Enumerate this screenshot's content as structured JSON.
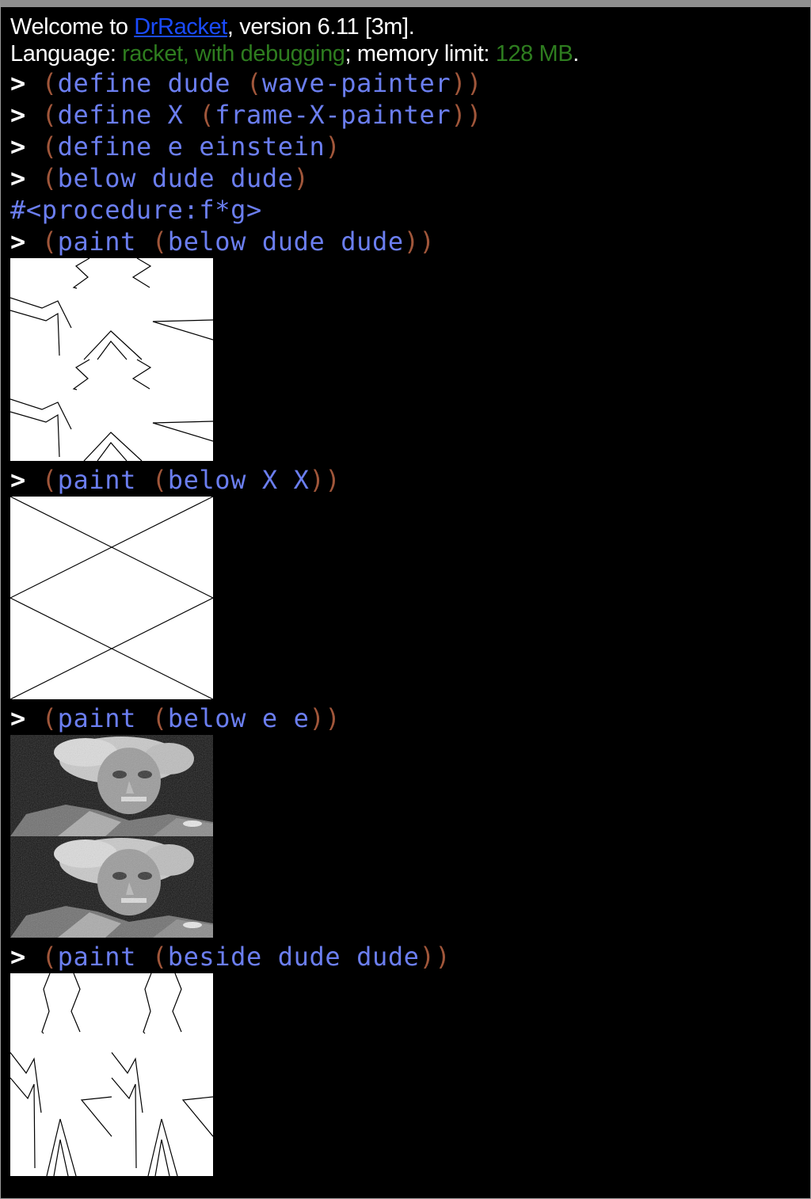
{
  "banner": {
    "welcome_prefix": "Welcome to ",
    "app_link": "DrRacket",
    "version_suffix": ", version 6.11 [3m].",
    "language_prefix": "Language: ",
    "language_value": "racket, with debugging",
    "memory_prefix": "; memory limit: ",
    "memory_value": "128 MB",
    "memory_suffix": "."
  },
  "prompt_symbol": ">",
  "interactions": [
    {
      "open": "(",
      "text": "define dude ",
      "inner_open": "(",
      "inner": "wave-painter",
      "close": "))"
    },
    {
      "open": "(",
      "text": "define X ",
      "inner_open": "(",
      "inner": "frame-X-painter",
      "close": "))"
    },
    {
      "open": "(",
      "text": "define e einstein",
      "close": ")"
    },
    {
      "open": "(",
      "text": "below dude dude",
      "close": ")"
    }
  ],
  "result_procedure": "#<procedure:f*g>",
  "paint_commands": [
    {
      "open": "(",
      "head": "paint ",
      "inner_open": "(",
      "inner": "below dude dude",
      "close": "))",
      "image": "two-wave-figures-stacked"
    },
    {
      "open": "(",
      "head": "paint ",
      "inner_open": "(",
      "inner": "below X X",
      "close": "))",
      "image": "two-x-frames-stacked"
    },
    {
      "open": "(",
      "head": "paint ",
      "inner_open": "(",
      "inner": "below e e",
      "close": "))",
      "image": "two-einstein-photos-stacked"
    },
    {
      "open": "(",
      "head": "paint ",
      "inner_open": "(",
      "inner": "beside dude dude",
      "close": "))",
      "image": "two-wave-figures-side-by-side"
    }
  ],
  "colors": {
    "background": "#000000",
    "prompt": "#ffffff",
    "paren": "#a0563a",
    "symbol": "#6b7ef0",
    "link": "#1a4bff",
    "language_green": "#2e7d1f"
  }
}
